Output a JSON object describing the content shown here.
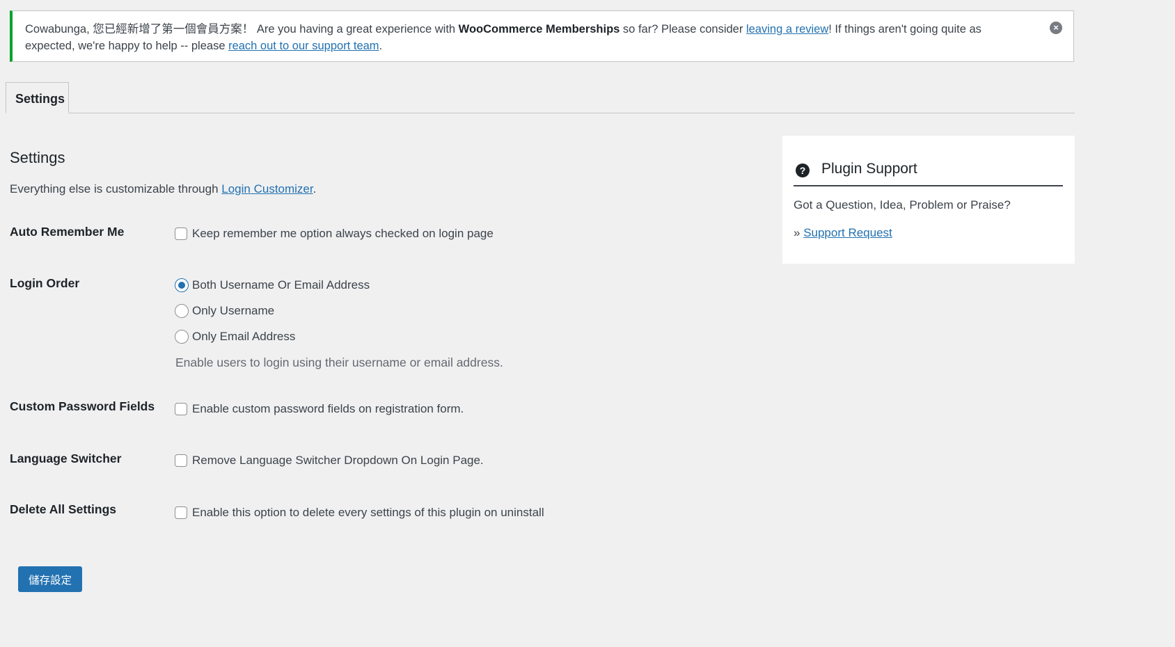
{
  "notice": {
    "text_prefix": "Cowabunga, 您已經新增了第一個會員方案！ Are you having a great experience with ",
    "product": "WooCommerce Memberships",
    "text_mid": " so far? Please consider ",
    "review_link": "leaving a review",
    "text_after": "! If things aren't going quite as expected, we're happy to help -- please ",
    "support_link": "reach out to our support team",
    "text_end": ".",
    "dismiss_icon": "×"
  },
  "tabs": [
    {
      "label": "Settings",
      "active": true
    }
  ],
  "main": {
    "title": "Settings",
    "intro_text": "Everything else is customizable through ",
    "intro_link": "Login Customizer",
    "intro_end": "."
  },
  "settings": {
    "auto_remember": {
      "label": "Auto Remember Me",
      "option": "Keep remember me option always checked on login page",
      "checked": false
    },
    "login_order": {
      "label": "Login Order",
      "options": [
        {
          "label": "Both Username Or Email Address",
          "checked": true
        },
        {
          "label": "Only Username",
          "checked": false
        },
        {
          "label": "Only Email Address",
          "checked": false
        }
      ],
      "description": "Enable users to login using their username or email address."
    },
    "custom_password": {
      "label": "Custom Password Fields",
      "option": "Enable custom password fields on registration form.",
      "checked": false
    },
    "language_switcher": {
      "label": "Language Switcher",
      "option": "Remove Language Switcher Dropdown On Login Page.",
      "checked": false
    },
    "delete_all": {
      "label": "Delete All Settings",
      "option": "Enable this option to delete every settings of this plugin on uninstall",
      "checked": false
    }
  },
  "save_button": "儲存設定",
  "support": {
    "icon": "?",
    "title": "Plugin Support",
    "question": "Got a Question, Idea, Problem or Praise?",
    "link_prefix": "» ",
    "link": "Support Request"
  },
  "colors": {
    "accent": "#2271b1",
    "notice_border": "#00a32a",
    "background": "#f0f0f1"
  }
}
